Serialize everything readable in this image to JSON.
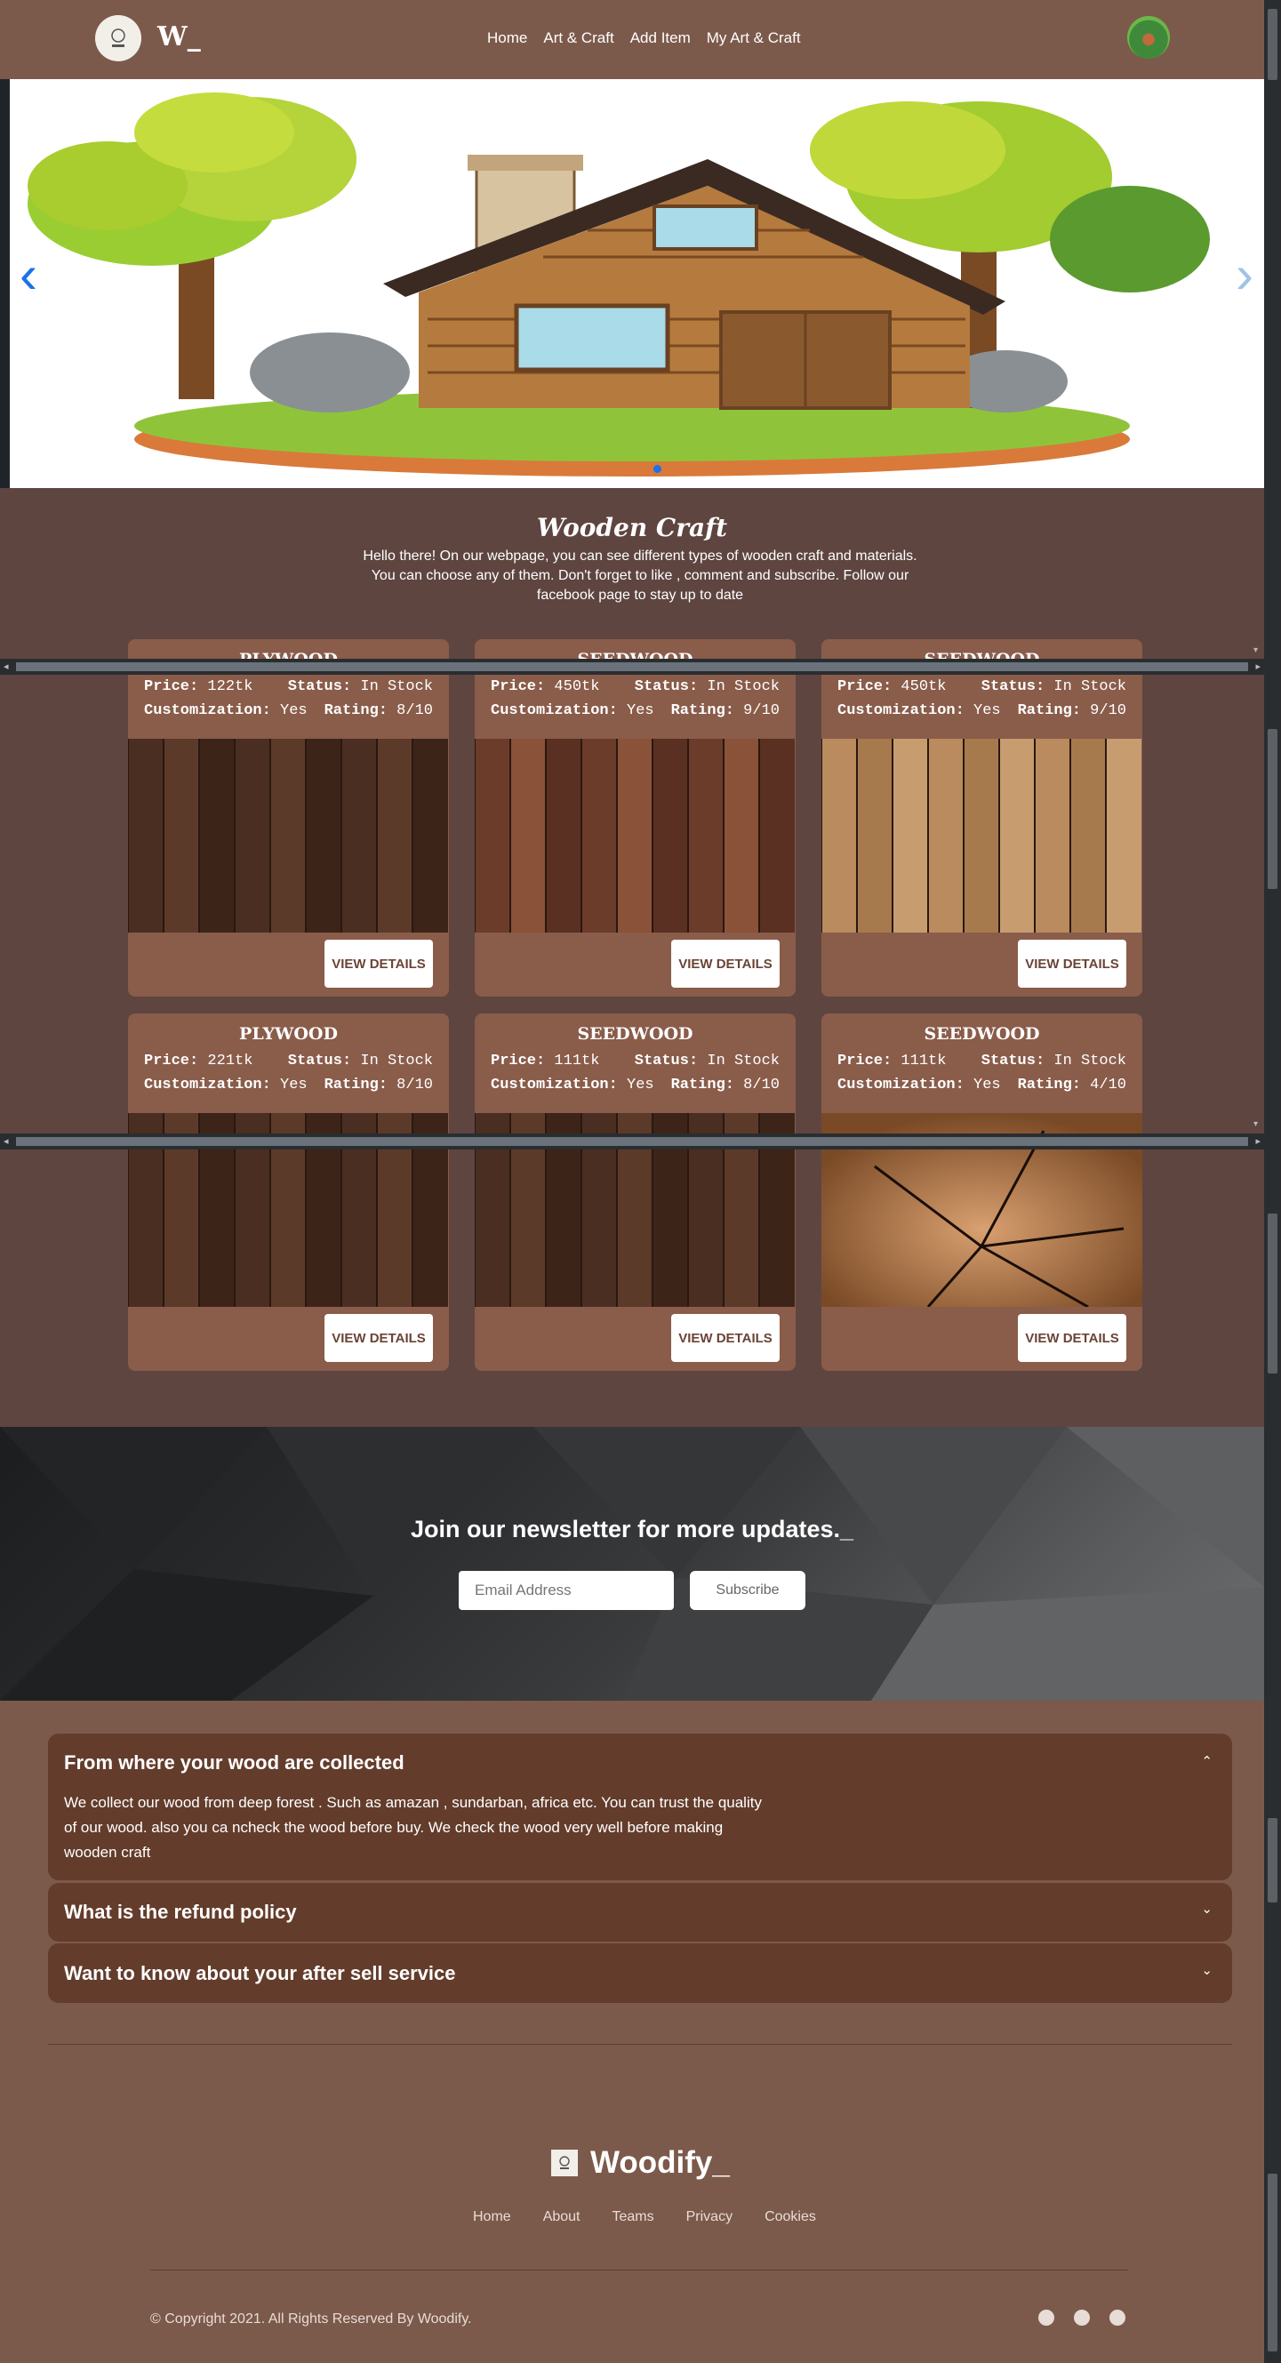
{
  "nav": {
    "brand": "W_",
    "links": [
      "Home",
      "Art & Craft",
      "Add Item",
      "My Art & Craft"
    ]
  },
  "hero": {
    "prev_icon": "chevron-left-icon",
    "next_icon": "chevron-right-icon"
  },
  "craft": {
    "title": "Wooden Craft",
    "description": "Hello there! On our webpage, you can see different types of wooden craft and materials. You can choose any of them. Don't forget to like , comment and subscribe. Follow our facebook page to stay up to date",
    "price_label": "Price:",
    "status_label": "Status:",
    "custom_label": "Customization:",
    "rating_label": "Rating:",
    "button_label": "VIEW DETAILS",
    "cards": [
      {
        "name": "PLYWOOD",
        "price": "122tk",
        "status": "In Stock",
        "custom": "Yes",
        "rating": "8/10"
      },
      {
        "name": "SEEDWOOD",
        "price": "450tk",
        "status": "In Stock",
        "custom": "Yes",
        "rating": "9/10"
      },
      {
        "name": "SEEDWOOD",
        "price": "450tk",
        "status": "In Stock",
        "custom": "Yes",
        "rating": "9/10"
      },
      {
        "name": "PLYWOOD",
        "price": "221tk",
        "status": "In Stock",
        "custom": "Yes",
        "rating": "8/10"
      },
      {
        "name": "SEEDWOOD",
        "price": "111tk",
        "status": "In Stock",
        "custom": "Yes",
        "rating": "8/10"
      },
      {
        "name": "SEEDWOOD",
        "price": "111tk",
        "status": "In Stock",
        "custom": "Yes",
        "rating": "4/10"
      }
    ]
  },
  "newsletter": {
    "title": "Join our newsletter for more updates._",
    "email_placeholder": "Email Address",
    "subscribe_label": "Subscribe"
  },
  "faq": {
    "items": [
      {
        "question": "From where your wood are collected",
        "answer": "We collect our wood from deep forest . Such as amazan , sundarban, africa etc. You can trust the quality of our wood. also you ca ncheck the wood before buy. We check the wood very well before making wooden craft"
      },
      {
        "question": "What is the refund policy"
      },
      {
        "question": "Want to know about your after sell service"
      }
    ]
  },
  "footer": {
    "brand": "Woodify_",
    "links": [
      "Home",
      "About",
      "Teams",
      "Privacy",
      "Cookies"
    ],
    "copyright": "© Copyright 2021. All Rights Reserved By Woodify."
  }
}
